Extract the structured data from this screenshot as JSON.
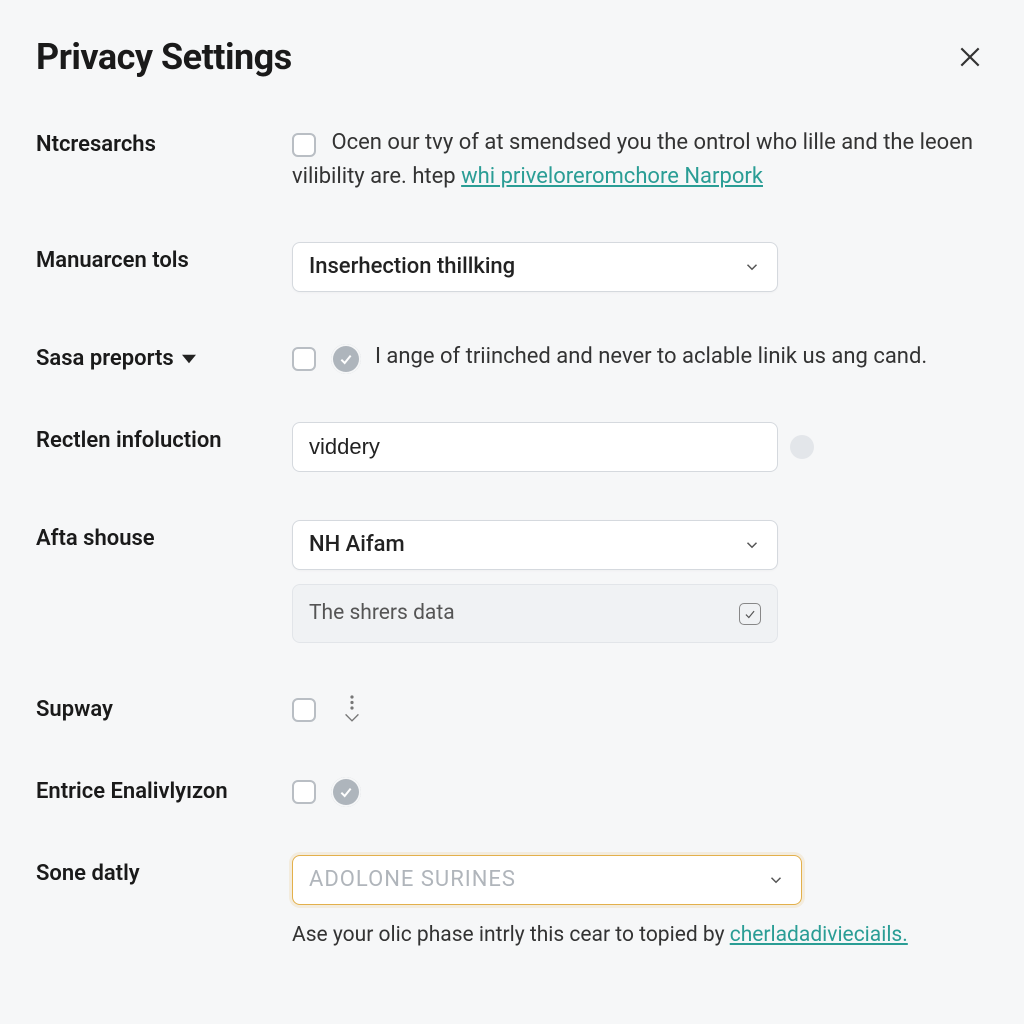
{
  "header": {
    "title": "Privacy Settings"
  },
  "rows": {
    "ntcresarchs": {
      "label": "Ntcresarchs",
      "text_before": "Ocen our tvy of at smendsed you the ontrol who lille and the leoen vilibility are. htep ",
      "link": "whi priveloreromchore Narpork"
    },
    "manuarcen": {
      "label": "Manuarcen tols",
      "select_value": "Inserhection thillking"
    },
    "sasa": {
      "label": "Sasa preports",
      "text": "I  ange of triinched and never to aclable linik us ang cand."
    },
    "rectlen": {
      "label": "Rectlen infoluction",
      "input_value": "viddery"
    },
    "afta": {
      "label": "Afta shouse",
      "select_value": "NH Aifam",
      "sub_label": "The shrers data"
    },
    "supway": {
      "label": "Supway"
    },
    "entrice": {
      "label": "Entrice Enalivlyızon"
    },
    "sone": {
      "label": "Sone datly",
      "placeholder": "ADOLONE SURINES",
      "footer_text": "Ase your olic phase intrly this cear to topied by  ",
      "footer_link": "cherladadivieciails."
    }
  }
}
